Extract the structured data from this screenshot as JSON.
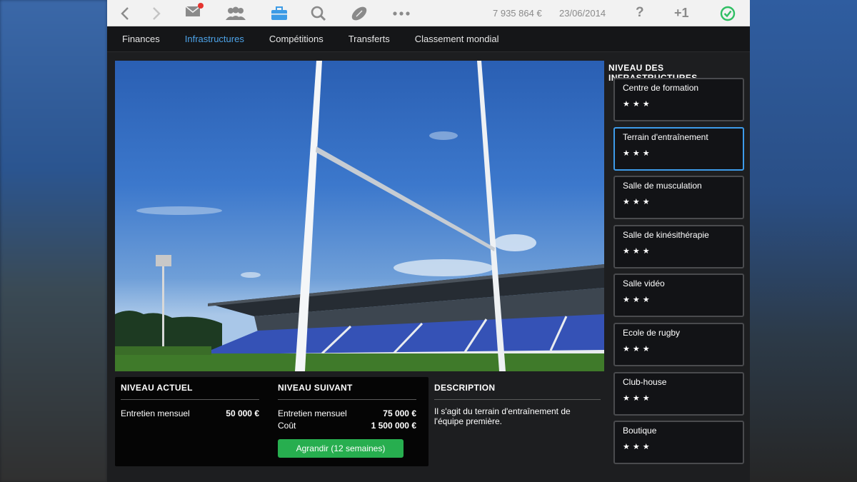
{
  "toolbar": {
    "money": "7 935 864 €",
    "date": "23/06/2014",
    "help": "?",
    "plus_one": "+1"
  },
  "tabs": [
    {
      "label": "Finances",
      "active": false
    },
    {
      "label": "Infrastructures",
      "active": true
    },
    {
      "label": "Compétitions",
      "active": false
    },
    {
      "label": "Transferts",
      "active": false
    },
    {
      "label": "Classement mondial",
      "active": false
    }
  ],
  "current_level": {
    "title": "NIVEAU ACTUEL",
    "maintenance_label": "Entretien mensuel",
    "maintenance_value": "50 000 €"
  },
  "next_level": {
    "title": "NIVEAU SUIVANT",
    "maintenance_label": "Entretien mensuel",
    "maintenance_value": "75 000 €",
    "cost_label": "Coût",
    "cost_value": "1 500 000 €",
    "upgrade_button": "Agrandir (12 semaines)"
  },
  "description": {
    "title": "DESCRIPTION",
    "text": "Il s'agit du terrain d'entraînement de l'équipe première."
  },
  "infrastructures": {
    "title": "NIVEAU DES INFRASTRUCTURES",
    "items": [
      {
        "name": "Centre de formation",
        "stars": "★★★",
        "selected": false
      },
      {
        "name": "Terrain d'entraînement",
        "stars": "★★★",
        "selected": true
      },
      {
        "name": "Salle de musculation",
        "stars": "★★★",
        "selected": false
      },
      {
        "name": "Salle de kinésithérapie",
        "stars": "★★★",
        "selected": false
      },
      {
        "name": "Salle vidéo",
        "stars": "★★★",
        "selected": false
      },
      {
        "name": "Ecole de rugby",
        "stars": "★★★",
        "selected": false
      },
      {
        "name": "Club-house",
        "stars": "★★★",
        "selected": false
      },
      {
        "name": "Boutique",
        "stars": "★★★",
        "selected": false
      }
    ]
  },
  "colors": {
    "accent_blue": "#4da3e8",
    "upgrade_green": "#27ae4f",
    "notification_red": "#e5342f",
    "clock_green": "#2fbf63"
  }
}
